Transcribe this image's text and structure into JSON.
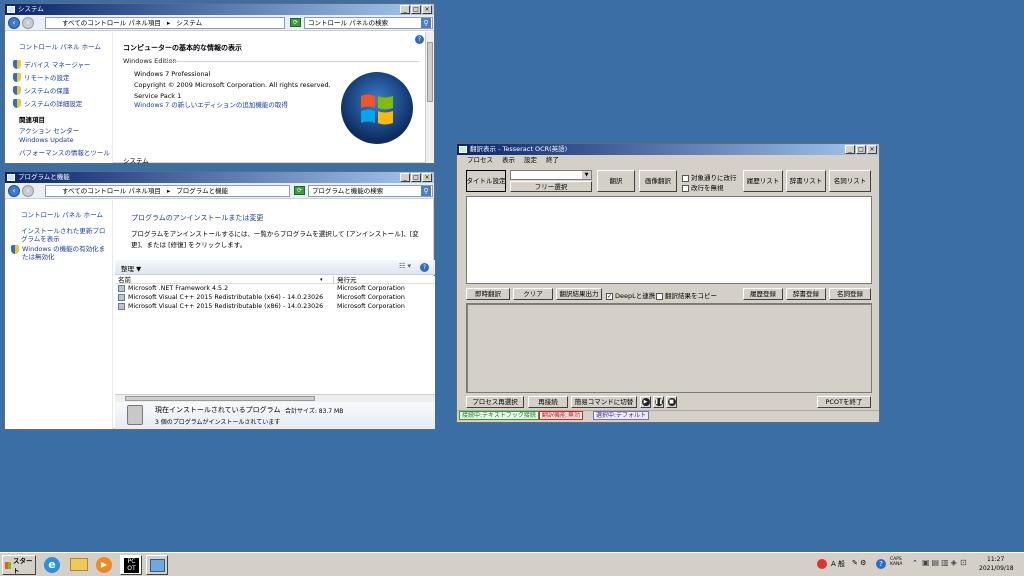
{
  "system_window": {
    "title": "システム",
    "breadcrumb": [
      "すべてのコントロール パネル項目",
      "システム"
    ],
    "search_placeholder": "コントロール パネルの検索",
    "side_home": "コントロール パネル ホーム",
    "side_links": [
      "デバイス マネージャー",
      "リモートの設定",
      "システムの保護",
      "システムの詳細設定"
    ],
    "related_heading": "関連項目",
    "related_links": [
      "アクション センター",
      "Windows Update",
      "パフォーマンスの情報とツール"
    ],
    "main_heading": "コンピューターの基本的な情報の表示",
    "edition_label": "Windows Edition",
    "edition": "Windows 7 Professional",
    "copyright": "Copyright © 2009 Microsoft Corporation.  All rights reserved.",
    "service_pack": "Service Pack 1",
    "upgrade_link": "Windows 7 の新しいエディションの追加機能の取得",
    "system_label": "システム"
  },
  "programs_window": {
    "title": "プログラムと機能",
    "breadcrumb": [
      "すべてのコントロール パネル項目",
      "プログラムと機能"
    ],
    "search_placeholder": "プログラムと機能の検索",
    "side_home": "コントロール パネル ホーム",
    "side_links": [
      "インストールされた更新プログラムを表示",
      "Windows の機能の有効化または無効化"
    ],
    "main_heading": "プログラムのアンインストールまたは変更",
    "description": "プログラムをアンインストールするには、一覧からプログラムを選択して [アンインストール]、[変更]、または [修復] をクリックします。",
    "organize": "整理 ▼",
    "columns": [
      "名前",
      "発行元"
    ],
    "rows": [
      {
        "name": "Microsoft .NET Framework 4.5.2",
        "publisher": "Microsoft Corporation"
      },
      {
        "name": "Microsoft Visual C++ 2015 Redistributable (x64) - 14.0.23026",
        "publisher": "Microsoft Corporation"
      },
      {
        "name": "Microsoft Visual C++ 2015 Redistributable (x86) - 14.0.23026",
        "publisher": "Microsoft Corporation"
      }
    ],
    "footer_title": "現在インストールされているプログラム",
    "footer_total": "合計サイズ: 83.7 MB",
    "footer_count": "3 個のプログラムがインストールされています"
  },
  "ocr_window": {
    "title": "翻訳表示 - Tesseract OCR(英語)",
    "menu": [
      "プロセス",
      "表示",
      "設定",
      "終了"
    ],
    "buttons": {
      "title_setting": "タイトル設定",
      "free_select": "フリー選択",
      "translate": "翻訳",
      "image_translate": "画像翻訳",
      "history_list": "履歴リスト",
      "dict_list": "辞書リスト",
      "noun_list": "名詞リスト",
      "instant_translate": "即時翻訳",
      "clear": "クリア",
      "output_result": "翻訳結果出力",
      "history_register": "履歴登録",
      "dict_register": "辞書登録",
      "noun_register": "名詞登録",
      "process_reselect": "プロセス再選択",
      "reconnect": "再接続",
      "simple_command": "簡易コマンドに切替",
      "pcot_exit": "PCOTを終了"
    },
    "checks": {
      "target_newline": "対象通りに改行",
      "ignore_newline": "改行を無視",
      "deepl": "DeepLと連携",
      "copy_result": "翻訳結果をコピー"
    },
    "status": [
      "接続中:テキストフック接続",
      "翻訳機能:無効",
      "選択中:デフォルト"
    ]
  },
  "taskbar": {
    "start": "スタート",
    "time": "11:27",
    "date": "2021/09/18",
    "ime": "A 般"
  }
}
